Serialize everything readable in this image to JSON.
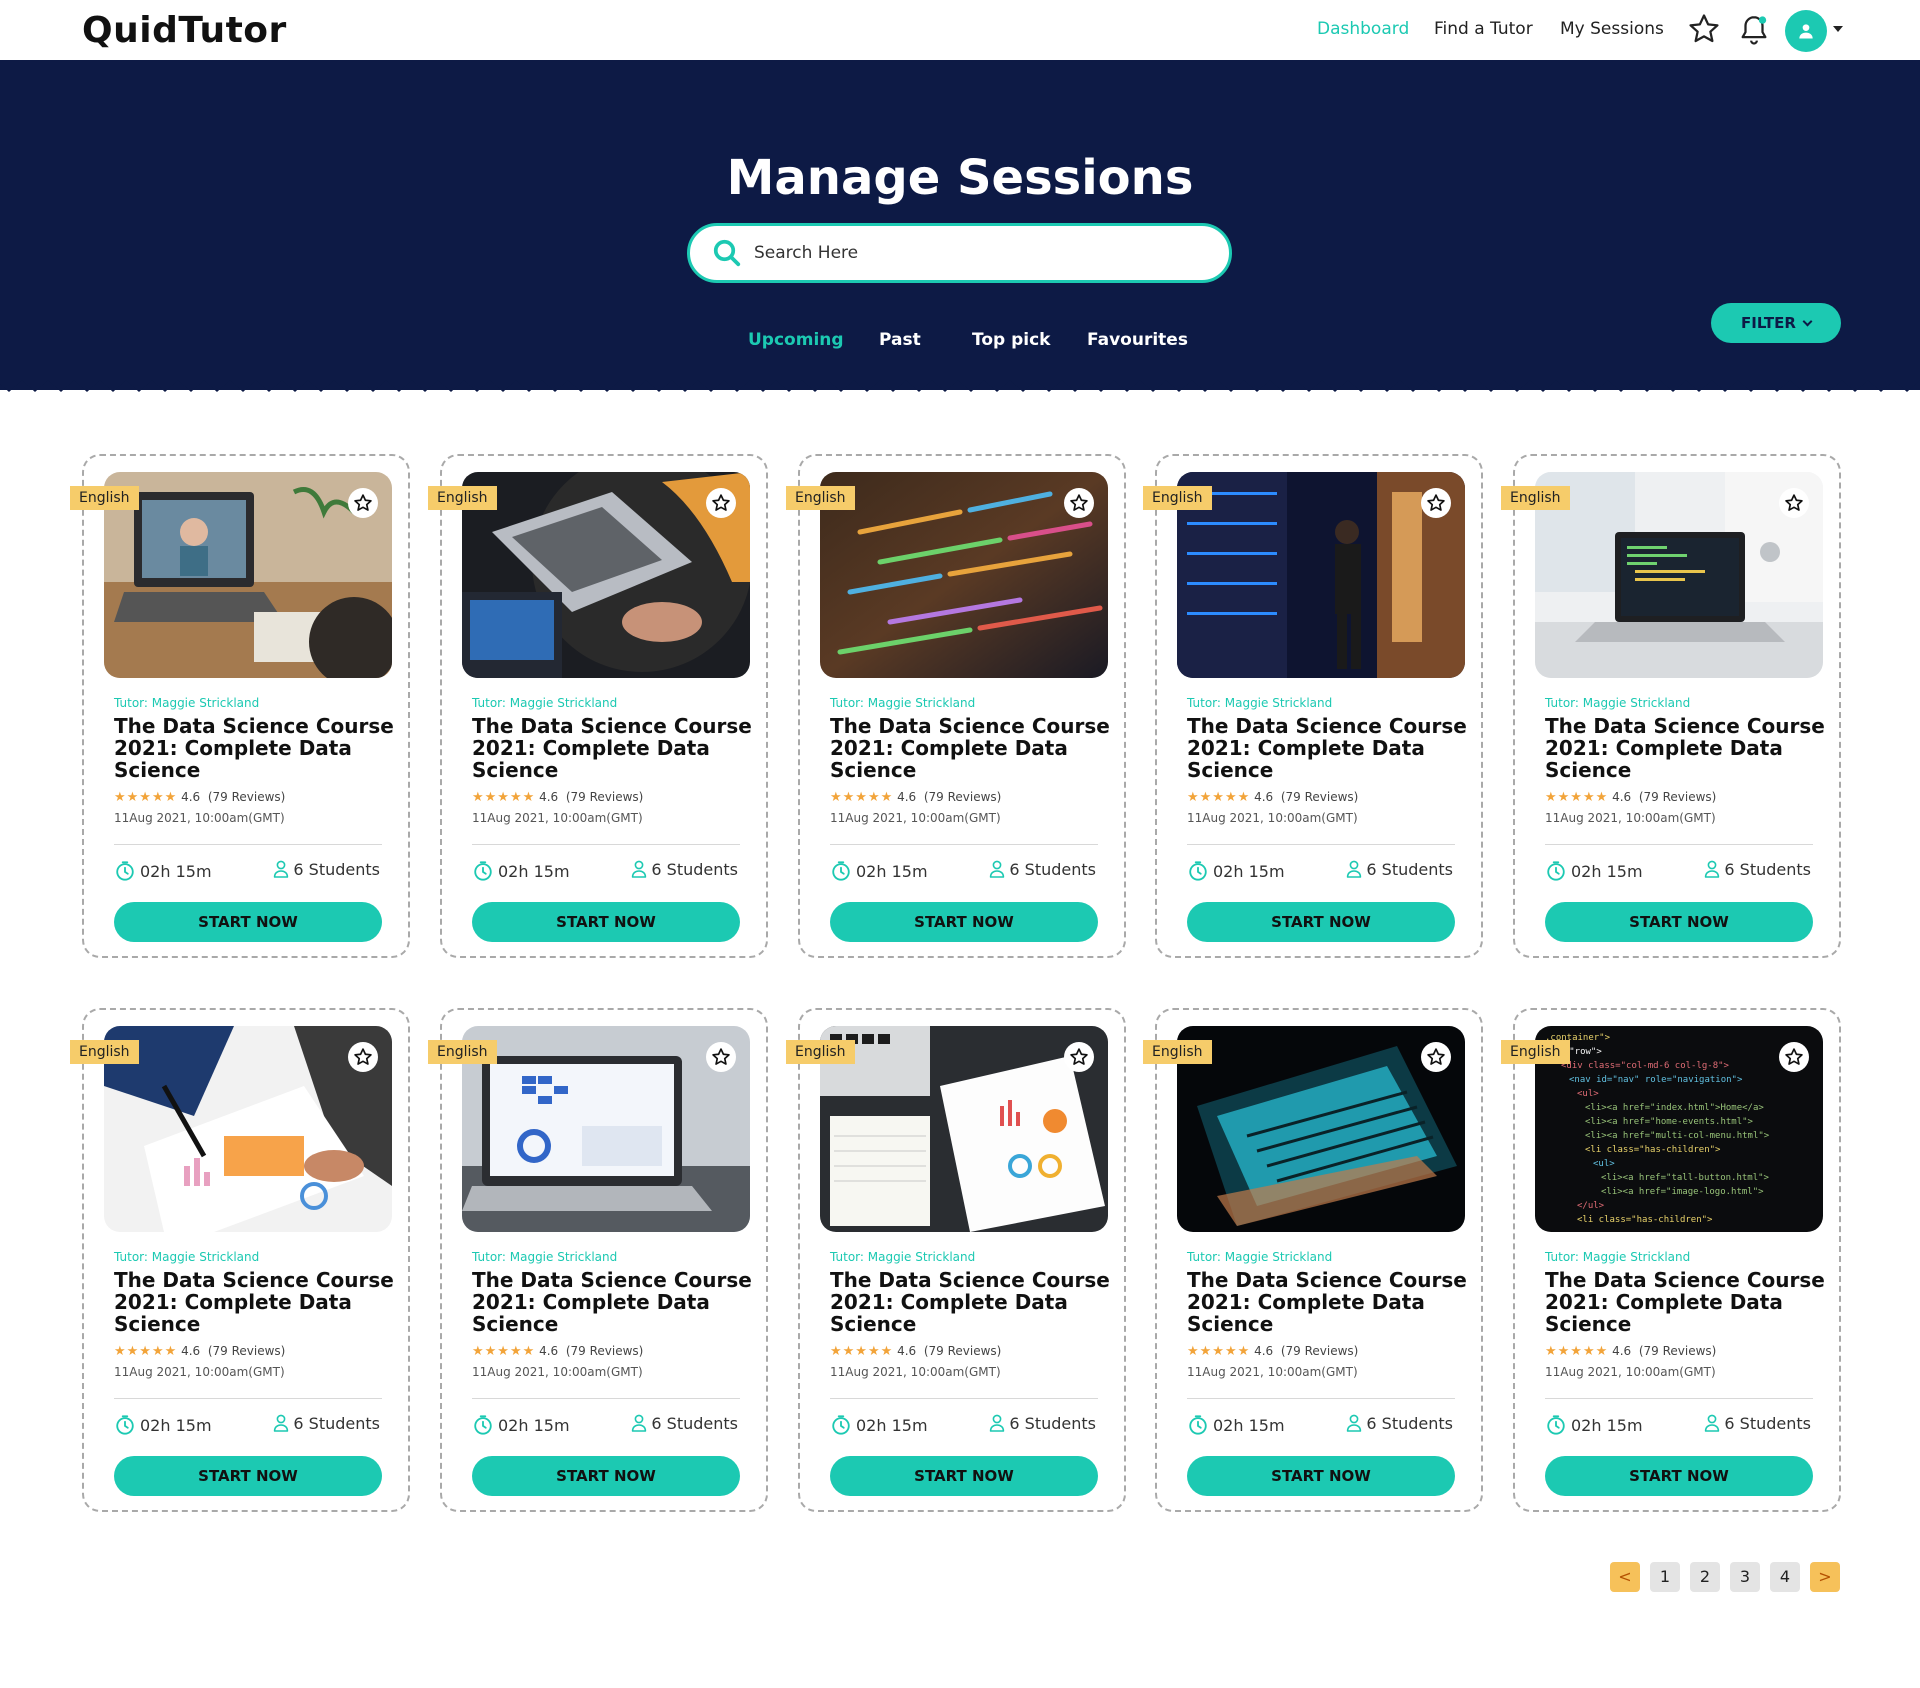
{
  "app": {
    "logo": "QuidTutor"
  },
  "nav": {
    "items": [
      "Dashboard",
      "Find a Tutor",
      "My Sessions"
    ],
    "active": "Dashboard",
    "accent": "#1cc9b2"
  },
  "hero": {
    "title": "Manage Sessions",
    "search_placeholder": "Search Here",
    "tabs": [
      "Upcoming",
      "Past",
      "Top pick",
      "Favourites"
    ],
    "active_tab": "Upcoming",
    "filter_label": "FILTER",
    "background": "#0d1a45"
  },
  "cards": [
    {
      "lang": "English",
      "tutor": "Tutor: Maggie Strickland",
      "title": "The Data Science Course 2021: Complete Data Science",
      "rating": "4.6",
      "reviews": "(79 Reviews)",
      "date": "11Aug 2021, 10:00am(GMT)",
      "duration": "02h 15m",
      "students": "6 Students",
      "cta": "START NOW",
      "image": "video-call-laptop"
    },
    {
      "lang": "English",
      "tutor": "Tutor: Maggie Strickland",
      "title": "The Data Science Course 2021: Complete Data Science",
      "rating": "4.6",
      "reviews": "(79 Reviews)",
      "date": "11Aug 2021, 10:00am(GMT)",
      "duration": "02h 15m",
      "students": "6 Students",
      "cta": "START NOW",
      "image": "laptops-dark-desk"
    },
    {
      "lang": "English",
      "tutor": "Tutor: Maggie Strickland",
      "title": "The Data Science Course 2021: Complete Data Science",
      "rating": "4.6",
      "reviews": "(79 Reviews)",
      "date": "11Aug 2021, 10:00am(GMT)",
      "duration": "02h 15m",
      "students": "6 Students",
      "cta": "START NOW",
      "image": "colorful-code-screen"
    },
    {
      "lang": "English",
      "tutor": "Tutor: Maggie Strickland",
      "title": "The Data Science Course 2021: Complete Data Science",
      "rating": "4.6",
      "reviews": "(79 Reviews)",
      "date": "11Aug 2021, 10:00am(GMT)",
      "duration": "02h 15m",
      "students": "6 Students",
      "cta": "START NOW",
      "image": "server-room"
    },
    {
      "lang": "English",
      "tutor": "Tutor: Maggie Strickland",
      "title": "The Data Science Course 2021: Complete Data Science",
      "rating": "4.6",
      "reviews": "(79 Reviews)",
      "date": "11Aug 2021, 10:00am(GMT)",
      "duration": "02h 15m",
      "students": "6 Students",
      "cta": "START NOW",
      "image": "laptop-white-desk"
    },
    {
      "lang": "English",
      "tutor": "Tutor: Maggie Strickland",
      "title": "The Data Science Course 2021: Complete Data Science",
      "rating": "4.6",
      "reviews": "(79 Reviews)",
      "date": "11Aug 2021, 10:00am(GMT)",
      "duration": "02h 15m",
      "students": "6 Students",
      "cta": "START NOW",
      "image": "charts-on-paper"
    },
    {
      "lang": "English",
      "tutor": "Tutor: Maggie Strickland",
      "title": "The Data Science Course 2021: Complete Data Science",
      "rating": "4.6",
      "reviews": "(79 Reviews)",
      "date": "11Aug 2021, 10:00am(GMT)",
      "duration": "02h 15m",
      "students": "6 Students",
      "cta": "START NOW",
      "image": "laptop-dashboard"
    },
    {
      "lang": "English",
      "tutor": "Tutor: Maggie Strickland",
      "title": "The Data Science Course 2021: Complete Data Science",
      "rating": "4.6",
      "reviews": "(79 Reviews)",
      "date": "11Aug 2021, 10:00am(GMT)",
      "duration": "02h 15m",
      "students": "6 Students",
      "cta": "START NOW",
      "image": "notebook-charts"
    },
    {
      "lang": "English",
      "tutor": "Tutor: Maggie Strickland",
      "title": "The Data Science Course 2021: Complete Data Science",
      "rating": "4.6",
      "reviews": "(79 Reviews)",
      "date": "11Aug 2021, 10:00am(GMT)",
      "duration": "02h 15m",
      "students": "6 Students",
      "cta": "START NOW",
      "image": "glowing-laptop"
    },
    {
      "lang": "English",
      "tutor": "Tutor: Maggie Strickland",
      "title": "The Data Science Course 2021: Complete Data Science",
      "rating": "4.6",
      "reviews": "(79 Reviews)",
      "date": "11Aug 2021, 10:00am(GMT)",
      "duration": "02h 15m",
      "students": "6 Students",
      "cta": "START NOW",
      "image": "html-code"
    }
  ],
  "pagination": {
    "prev": "<",
    "pages": [
      "1",
      "2",
      "3",
      "4"
    ],
    "next": ">"
  }
}
